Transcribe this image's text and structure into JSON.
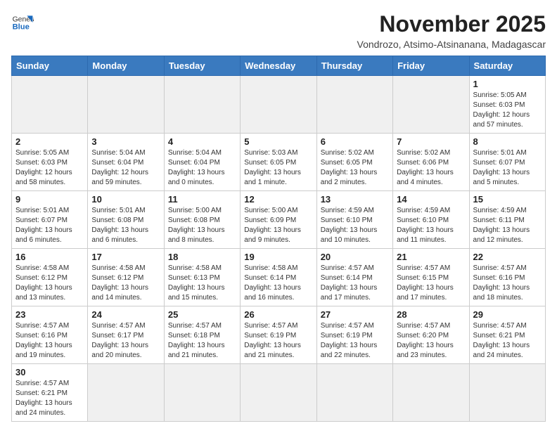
{
  "header": {
    "logo_general": "General",
    "logo_blue": "Blue",
    "month_title": "November 2025",
    "location": "Vondrozo, Atsimo-Atsinanana, Madagascar"
  },
  "days_of_week": [
    "Sunday",
    "Monday",
    "Tuesday",
    "Wednesday",
    "Thursday",
    "Friday",
    "Saturday"
  ],
  "weeks": [
    [
      {
        "day": "",
        "info": ""
      },
      {
        "day": "",
        "info": ""
      },
      {
        "day": "",
        "info": ""
      },
      {
        "day": "",
        "info": ""
      },
      {
        "day": "",
        "info": ""
      },
      {
        "day": "",
        "info": ""
      },
      {
        "day": "1",
        "info": "Sunrise: 5:05 AM\nSunset: 6:03 PM\nDaylight: 12 hours\nand 57 minutes."
      }
    ],
    [
      {
        "day": "2",
        "info": "Sunrise: 5:05 AM\nSunset: 6:03 PM\nDaylight: 12 hours\nand 58 minutes."
      },
      {
        "day": "3",
        "info": "Sunrise: 5:04 AM\nSunset: 6:04 PM\nDaylight: 12 hours\nand 59 minutes."
      },
      {
        "day": "4",
        "info": "Sunrise: 5:04 AM\nSunset: 6:04 PM\nDaylight: 13 hours\nand 0 minutes."
      },
      {
        "day": "5",
        "info": "Sunrise: 5:03 AM\nSunset: 6:05 PM\nDaylight: 13 hours\nand 1 minute."
      },
      {
        "day": "6",
        "info": "Sunrise: 5:02 AM\nSunset: 6:05 PM\nDaylight: 13 hours\nand 2 minutes."
      },
      {
        "day": "7",
        "info": "Sunrise: 5:02 AM\nSunset: 6:06 PM\nDaylight: 13 hours\nand 4 minutes."
      },
      {
        "day": "8",
        "info": "Sunrise: 5:01 AM\nSunset: 6:07 PM\nDaylight: 13 hours\nand 5 minutes."
      }
    ],
    [
      {
        "day": "9",
        "info": "Sunrise: 5:01 AM\nSunset: 6:07 PM\nDaylight: 13 hours\nand 6 minutes."
      },
      {
        "day": "10",
        "info": "Sunrise: 5:01 AM\nSunset: 6:08 PM\nDaylight: 13 hours\nand 6 minutes."
      },
      {
        "day": "11",
        "info": "Sunrise: 5:00 AM\nSunset: 6:08 PM\nDaylight: 13 hours\nand 8 minutes."
      },
      {
        "day": "12",
        "info": "Sunrise: 5:00 AM\nSunset: 6:09 PM\nDaylight: 13 hours\nand 9 minutes."
      },
      {
        "day": "13",
        "info": "Sunrise: 4:59 AM\nSunset: 6:10 PM\nDaylight: 13 hours\nand 10 minutes."
      },
      {
        "day": "14",
        "info": "Sunrise: 4:59 AM\nSunset: 6:10 PM\nDaylight: 13 hours\nand 11 minutes."
      },
      {
        "day": "15",
        "info": "Sunrise: 4:59 AM\nSunset: 6:11 PM\nDaylight: 13 hours\nand 12 minutes."
      }
    ],
    [
      {
        "day": "16",
        "info": "Sunrise: 4:58 AM\nSunset: 6:12 PM\nDaylight: 13 hours\nand 13 minutes."
      },
      {
        "day": "17",
        "info": "Sunrise: 4:58 AM\nSunset: 6:12 PM\nDaylight: 13 hours\nand 14 minutes."
      },
      {
        "day": "18",
        "info": "Sunrise: 4:58 AM\nSunset: 6:13 PM\nDaylight: 13 hours\nand 15 minutes."
      },
      {
        "day": "19",
        "info": "Sunrise: 4:58 AM\nSunset: 6:14 PM\nDaylight: 13 hours\nand 16 minutes."
      },
      {
        "day": "20",
        "info": "Sunrise: 4:57 AM\nSunset: 6:14 PM\nDaylight: 13 hours\nand 17 minutes."
      },
      {
        "day": "21",
        "info": "Sunrise: 4:57 AM\nSunset: 6:15 PM\nDaylight: 13 hours\nand 17 minutes."
      },
      {
        "day": "22",
        "info": "Sunrise: 4:57 AM\nSunset: 6:16 PM\nDaylight: 13 hours\nand 18 minutes."
      }
    ],
    [
      {
        "day": "23",
        "info": "Sunrise: 4:57 AM\nSunset: 6:16 PM\nDaylight: 13 hours\nand 19 minutes."
      },
      {
        "day": "24",
        "info": "Sunrise: 4:57 AM\nSunset: 6:17 PM\nDaylight: 13 hours\nand 20 minutes."
      },
      {
        "day": "25",
        "info": "Sunrise: 4:57 AM\nSunset: 6:18 PM\nDaylight: 13 hours\nand 21 minutes."
      },
      {
        "day": "26",
        "info": "Sunrise: 4:57 AM\nSunset: 6:19 PM\nDaylight: 13 hours\nand 21 minutes."
      },
      {
        "day": "27",
        "info": "Sunrise: 4:57 AM\nSunset: 6:19 PM\nDaylight: 13 hours\nand 22 minutes."
      },
      {
        "day": "28",
        "info": "Sunrise: 4:57 AM\nSunset: 6:20 PM\nDaylight: 13 hours\nand 23 minutes."
      },
      {
        "day": "29",
        "info": "Sunrise: 4:57 AM\nSunset: 6:21 PM\nDaylight: 13 hours\nand 24 minutes."
      }
    ],
    [
      {
        "day": "30",
        "info": "Sunrise: 4:57 AM\nSunset: 6:21 PM\nDaylight: 13 hours\nand 24 minutes."
      },
      {
        "day": "",
        "info": ""
      },
      {
        "day": "",
        "info": ""
      },
      {
        "day": "",
        "info": ""
      },
      {
        "day": "",
        "info": ""
      },
      {
        "day": "",
        "info": ""
      },
      {
        "day": "",
        "info": ""
      }
    ]
  ]
}
